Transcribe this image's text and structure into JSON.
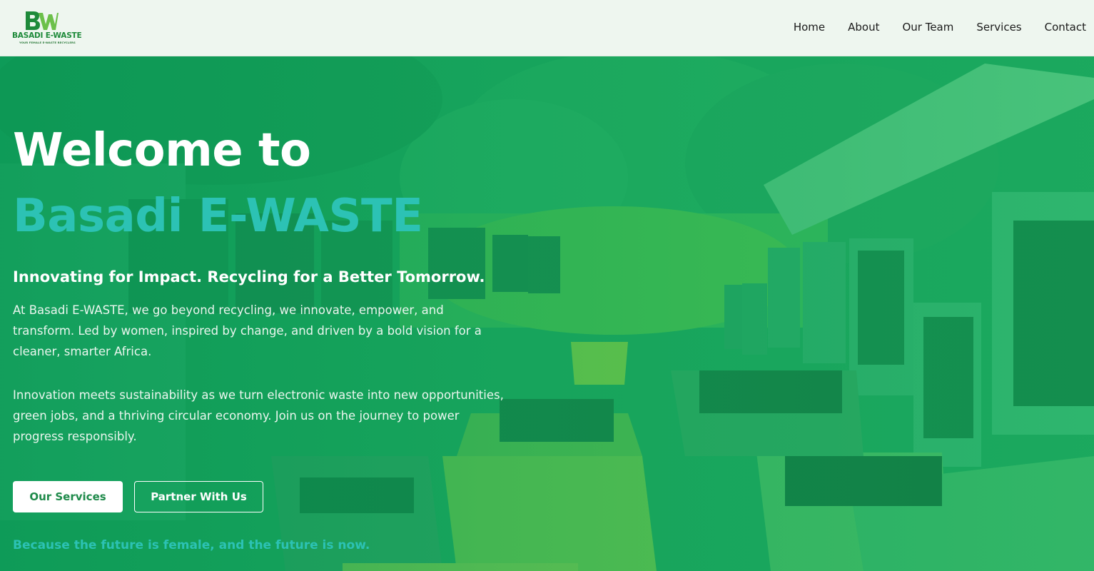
{
  "brand": {
    "logo_letters": "BW",
    "name": "BASADI E-WASTE",
    "tagline": "YOUR FEMALE E-WASTE RECYCLERS"
  },
  "nav": {
    "items": [
      {
        "label": "Home"
      },
      {
        "label": "About"
      },
      {
        "label": "Our Team"
      },
      {
        "label": "Services"
      },
      {
        "label": "Contact"
      }
    ]
  },
  "hero": {
    "title_line1": "Welcome to",
    "title_line2": "Basadi E-WASTE",
    "subtitle": "Innovating for Impact. Recycling for a Better Tomorrow.",
    "paragraph1": "At Basadi E-WASTE, we go beyond recycling, we innovate, empower, and transform. Led by women, inspired by change, and driven by a bold vision for a cleaner, smarter Africa.",
    "paragraph2": "Innovation meets sustainability as we turn electronic waste into new opportunities, green jobs, and a thriving circular economy. Join us on the journey to power progress responsibly.",
    "primary_button": "Our Services",
    "secondary_button": "Partner With Us",
    "tagline": "Because the future is female, and the future is now."
  },
  "colors": {
    "header_bg": "#eef6ef",
    "hero_green": "#0f9a55",
    "accent_teal": "#2cc2b4",
    "logo_green": "#1e8a3a"
  }
}
